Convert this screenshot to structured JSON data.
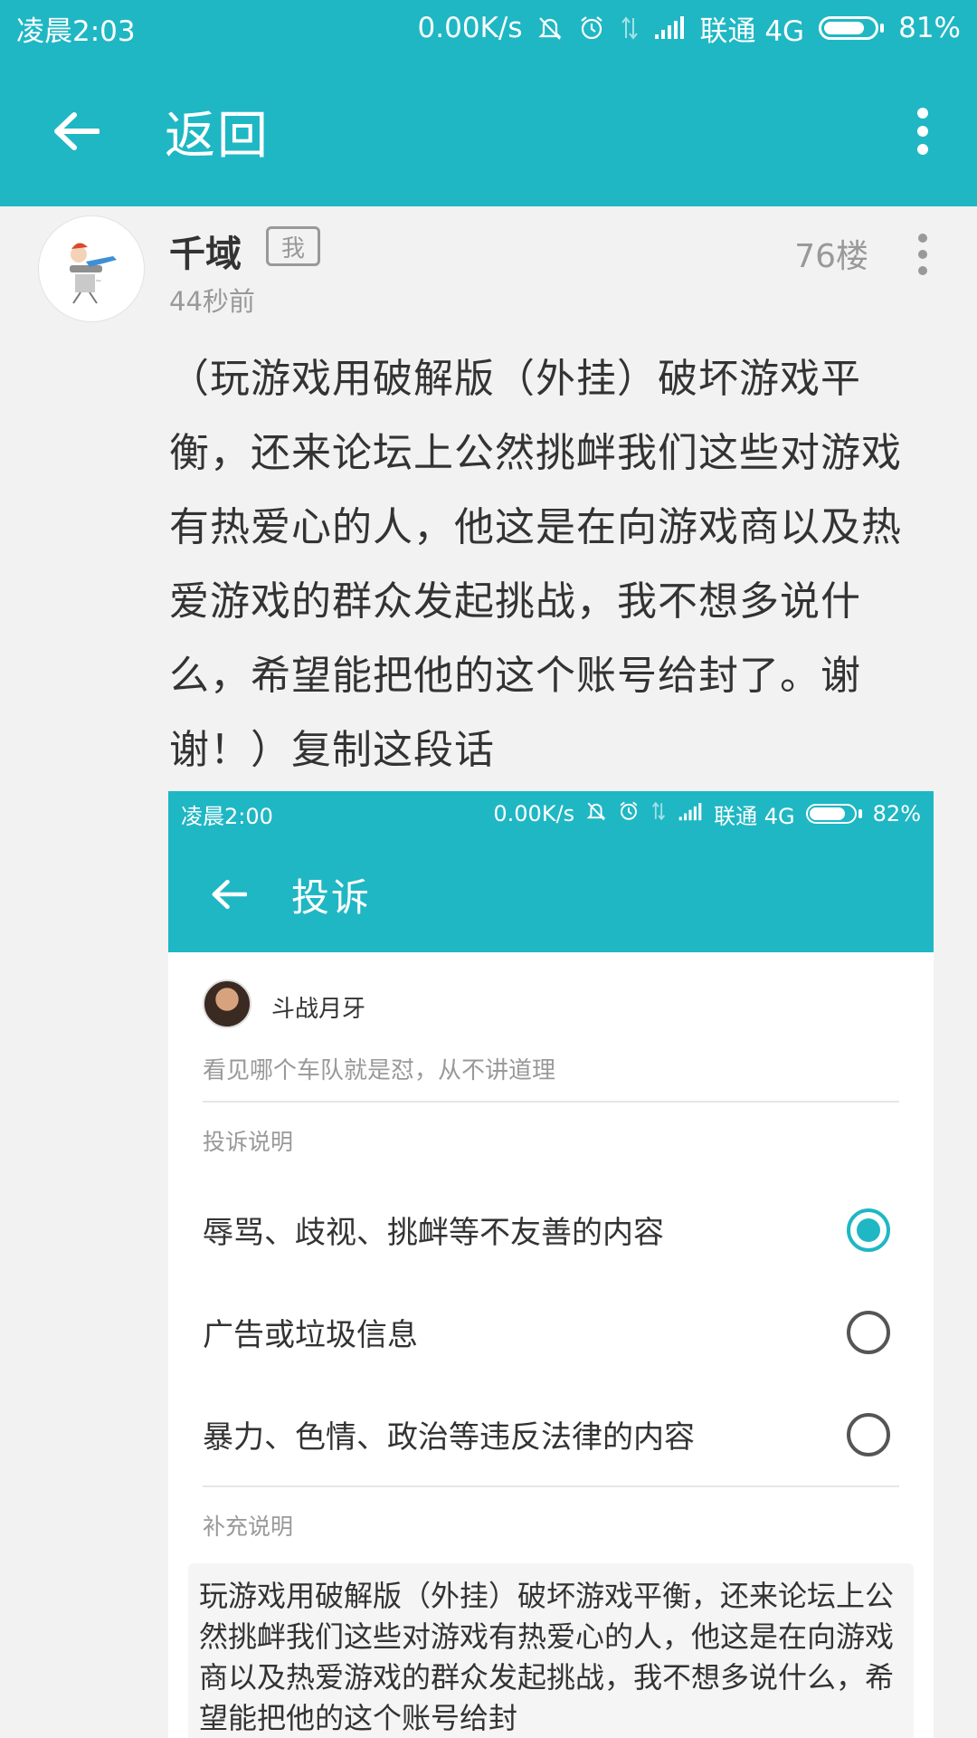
{
  "status_bar": {
    "time": "凌晨2:03",
    "speed": "0.00K/s",
    "carrier": "联通 4G",
    "battery": "81%",
    "battery_level": 0.81
  },
  "app_bar": {
    "title": "返回"
  },
  "post": {
    "username": "千域",
    "badge": "我",
    "time_ago": "44秒前",
    "floor": "76楼",
    "content": "（玩游戏用破解版（外挂）破坏游戏平衡，还来论坛上公然挑衅我们这些对游戏有热爱心的人，他这是在向游戏商以及热爱游戏的群众发起挑战，我不想多说什么，希望能把他的这个账号给封了。谢谢！）复制这段话"
  },
  "screenshot": {
    "status_bar": {
      "time": "凌晨2:00",
      "speed": "0.00K/s",
      "carrier": "联通 4G",
      "battery": "82%",
      "battery_level": 0.82
    },
    "app_bar": {
      "title": "投诉"
    },
    "reported_user": {
      "name": "斗战月牙",
      "signature": "看见哪个车队就是怼，从不讲道理"
    },
    "complaint_section_label": "投诉说明",
    "options": [
      {
        "label": "辱骂、歧视、挑衅等不友善的内容",
        "selected": true
      },
      {
        "label": "广告或垃圾信息",
        "selected": false
      },
      {
        "label": "暴力、色情、政治等违反法律的内容",
        "selected": false
      }
    ],
    "supplement_section_label": "补充说明",
    "supplement_text": "玩游戏用破解版（外挂）破坏游戏平衡，还来论坛上公然挑衅我们这些对游戏有热爱心的人，他这是在向游戏商以及热爱游戏的群众发起挑战，我不想多说什么，希望能把他的这个账号给封"
  },
  "colors": {
    "accent": "#1fb7c4",
    "background": "#f2f2f2",
    "muted_text": "#999999"
  }
}
